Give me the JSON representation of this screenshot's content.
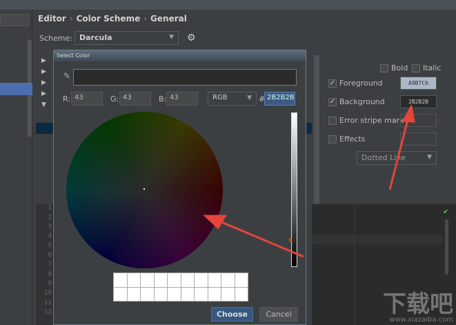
{
  "breadcrumb": [
    "Editor",
    "Color Scheme",
    "General"
  ],
  "scheme": {
    "label": "Scheme:",
    "value": "Darcula"
  },
  "attributes": {
    "bold": "Bold",
    "italic": "Italic",
    "foreground": {
      "label": "Foreground",
      "checked": true,
      "value": "A9B7C6",
      "color": "#a9b7c6"
    },
    "background": {
      "label": "Background",
      "checked": true,
      "value": "2B2B2B",
      "color": "#2b2b2b"
    },
    "error_stripe": "Error stripe mark",
    "effects": "Effects",
    "effect_type": "Dotted Line"
  },
  "gutter_lines": [
    "1",
    "2",
    "3",
    "4",
    "5",
    "6",
    "7",
    "8",
    "9",
    "10",
    "11",
    "12"
  ],
  "dialog": {
    "title": "Select Color",
    "r_label": "R:",
    "r": "43",
    "g_label": "G:",
    "g": "43",
    "b_label": "B:",
    "b": "43",
    "mode": "RGB",
    "hash": "#",
    "hex": "2B2B2B",
    "choose": "Choose",
    "cancel": "Cancel"
  },
  "watermark": {
    "text": "下载吧",
    "url": "www.xiazaiba.com"
  },
  "colors": {
    "accent": "#4b6eaf",
    "arrow": "#e8443a"
  }
}
